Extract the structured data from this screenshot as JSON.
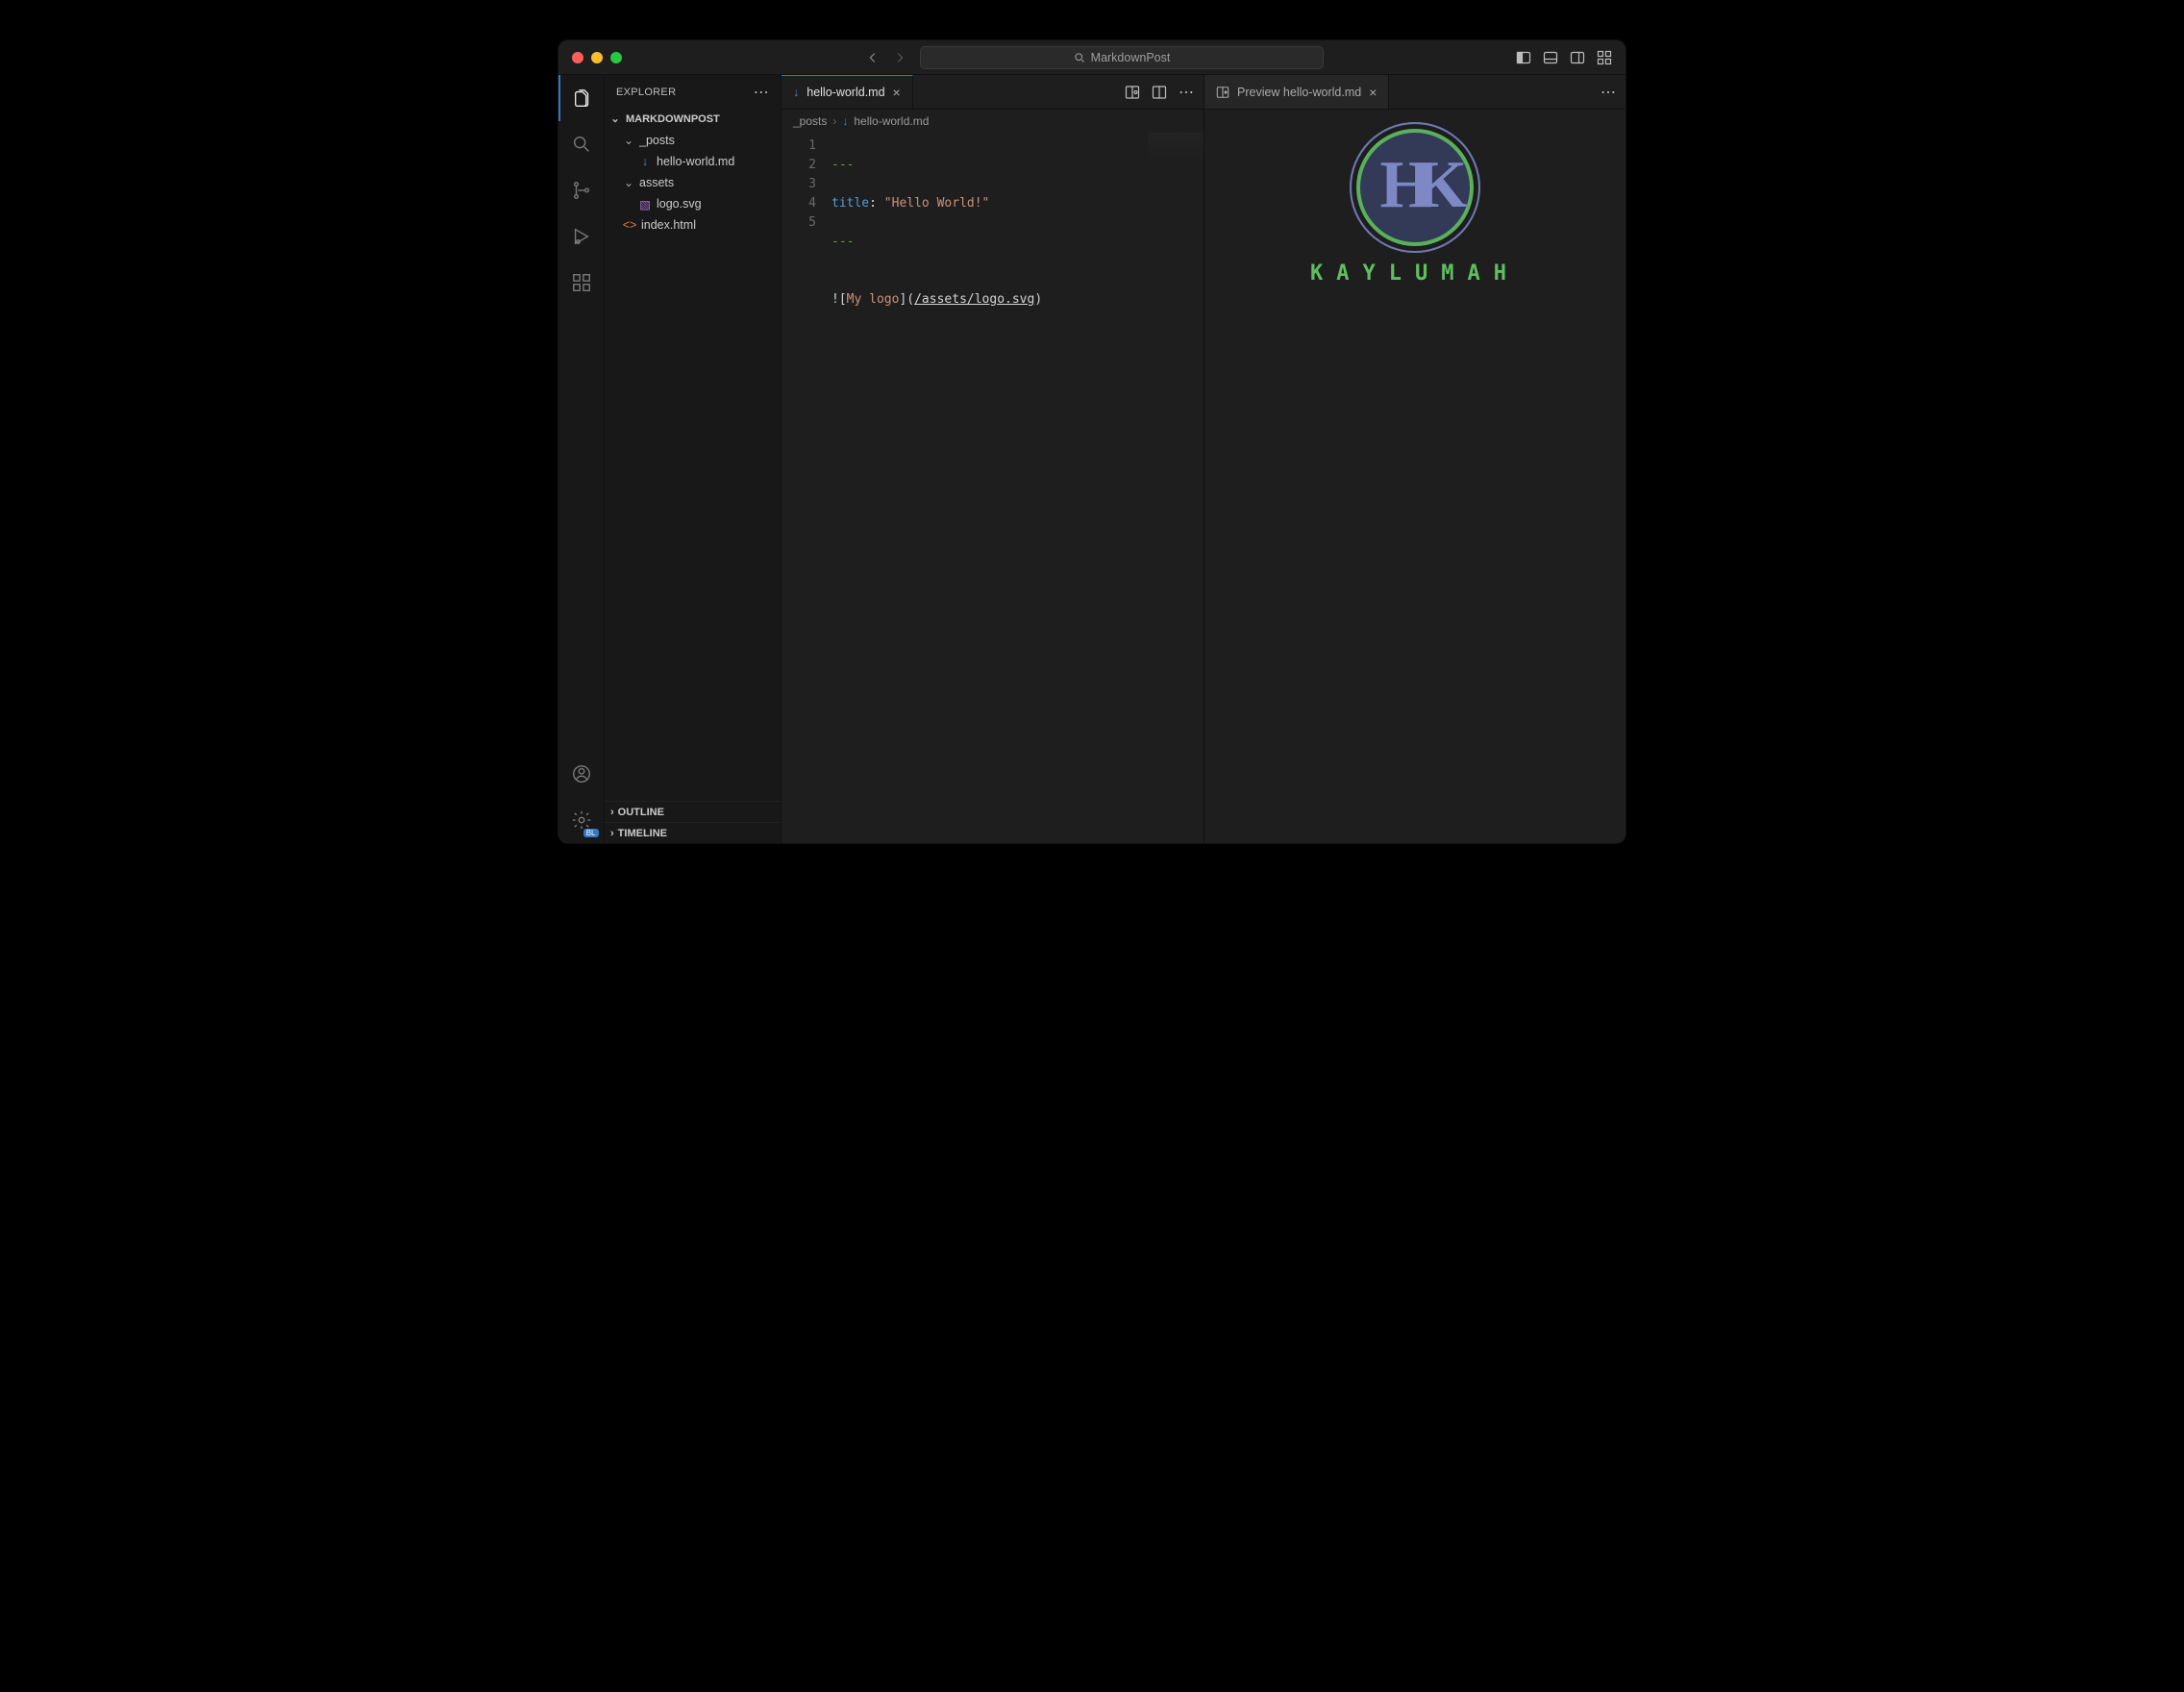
{
  "titlebar": {
    "search_label": "MarkdownPost"
  },
  "sidebar": {
    "header": "EXPLORER",
    "project": "MARKDOWNPOST",
    "tree": {
      "folder_posts": "_posts",
      "file_hello": "hello-world.md",
      "folder_assets": "assets",
      "file_logo": "logo.svg",
      "file_index": "index.html"
    },
    "outline": "OUTLINE",
    "timeline": "TIMELINE"
  },
  "editorLeft": {
    "tab_label": "hello-world.md",
    "breadcrumb_root": "_posts",
    "breadcrumb_file": "hello-world.md",
    "lines": {
      "n1": "1",
      "n2": "2",
      "n3": "3",
      "n4": "4",
      "n5": "5"
    },
    "code": {
      "l1": "---",
      "l2_key": "title",
      "l2_colon": ": ",
      "l2_str": "\"Hello World!\"",
      "l3": "---",
      "l4": "",
      "l5_bang": "!",
      "l5_lb": "[",
      "l5_alt": "My logo",
      "l5_rb": "]",
      "l5_lp": "(",
      "l5_url": "/assets/logo.svg",
      "l5_rp": ")"
    }
  },
  "editorRight": {
    "tab_label": "Preview hello-world.md",
    "brand_text": "KAYLUMAH",
    "monogram": "HK"
  }
}
